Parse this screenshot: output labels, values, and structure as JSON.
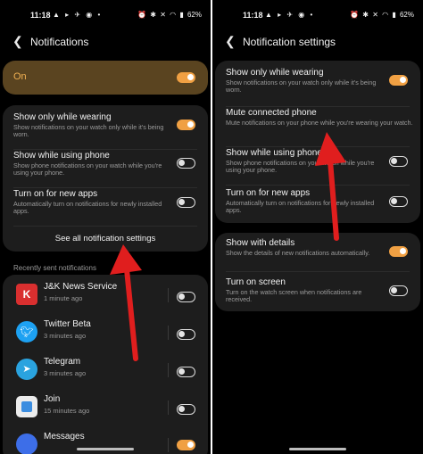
{
  "left": {
    "status": {
      "time": "11:18",
      "battery": "62%"
    },
    "header": {
      "title": "Notifications"
    },
    "master": {
      "label": "On",
      "on": true
    },
    "settings": [
      {
        "title": "Show only while wearing",
        "subtitle": "Show notifications on your watch only while it's being worn.",
        "on": true
      },
      {
        "title": "Show while using phone",
        "subtitle": "Show phone notifications on your watch while you're using your phone.",
        "on": false
      },
      {
        "title": "Turn on for new apps",
        "subtitle": "Automatically turn on notifications for newly installed apps.",
        "on": false
      }
    ],
    "see_all": "See all notification settings",
    "recent_label": "Recently sent notifications",
    "apps": [
      {
        "name": "J&K News Service",
        "time": "1 minute ago",
        "on": false,
        "icon": "jk-news-icon",
        "color": "#d92f2f"
      },
      {
        "name": "Twitter Beta",
        "time": "3 minutes ago",
        "on": false,
        "icon": "twitter-icon",
        "color": "#1da1f2"
      },
      {
        "name": "Telegram",
        "time": "3 minutes ago",
        "on": false,
        "icon": "telegram-icon",
        "color": "#2aa3df"
      },
      {
        "name": "Join",
        "time": "15 minutes ago",
        "on": false,
        "icon": "join-icon",
        "color": "#ececec"
      },
      {
        "name": "Messages",
        "time": "",
        "on": true,
        "icon": "messages-icon",
        "color": "#3d6ee8"
      }
    ]
  },
  "right": {
    "status": {
      "time": "11:18",
      "battery": "62%"
    },
    "header": {
      "title": "Notification settings"
    },
    "group1": [
      {
        "title": "Show only while wearing",
        "subtitle": "Show notifications on your watch only while it's being worn.",
        "on": true
      },
      {
        "title": "Mute connected phone",
        "subtitle": "Mute notifications on your phone while you're wearing your watch.",
        "on": null
      },
      {
        "title": "Show while using phone",
        "subtitle": "Show phone notifications on your watch while you're using your phone.",
        "on": false
      },
      {
        "title": "Turn on for new apps",
        "subtitle": "Automatically turn on notifications for newly installed apps.",
        "on": false
      }
    ],
    "group2": [
      {
        "title": "Show with details",
        "subtitle": "Show the details of new notifications automatically.",
        "on": true
      },
      {
        "title": "Turn on screen",
        "subtitle": "Turn on the watch screen when notifications are received.",
        "on": false
      }
    ]
  },
  "colors": {
    "accent": "#f0a043",
    "on_card": "#5a4420",
    "card": "#1d1d1d",
    "arrow": "#e01e1e"
  }
}
